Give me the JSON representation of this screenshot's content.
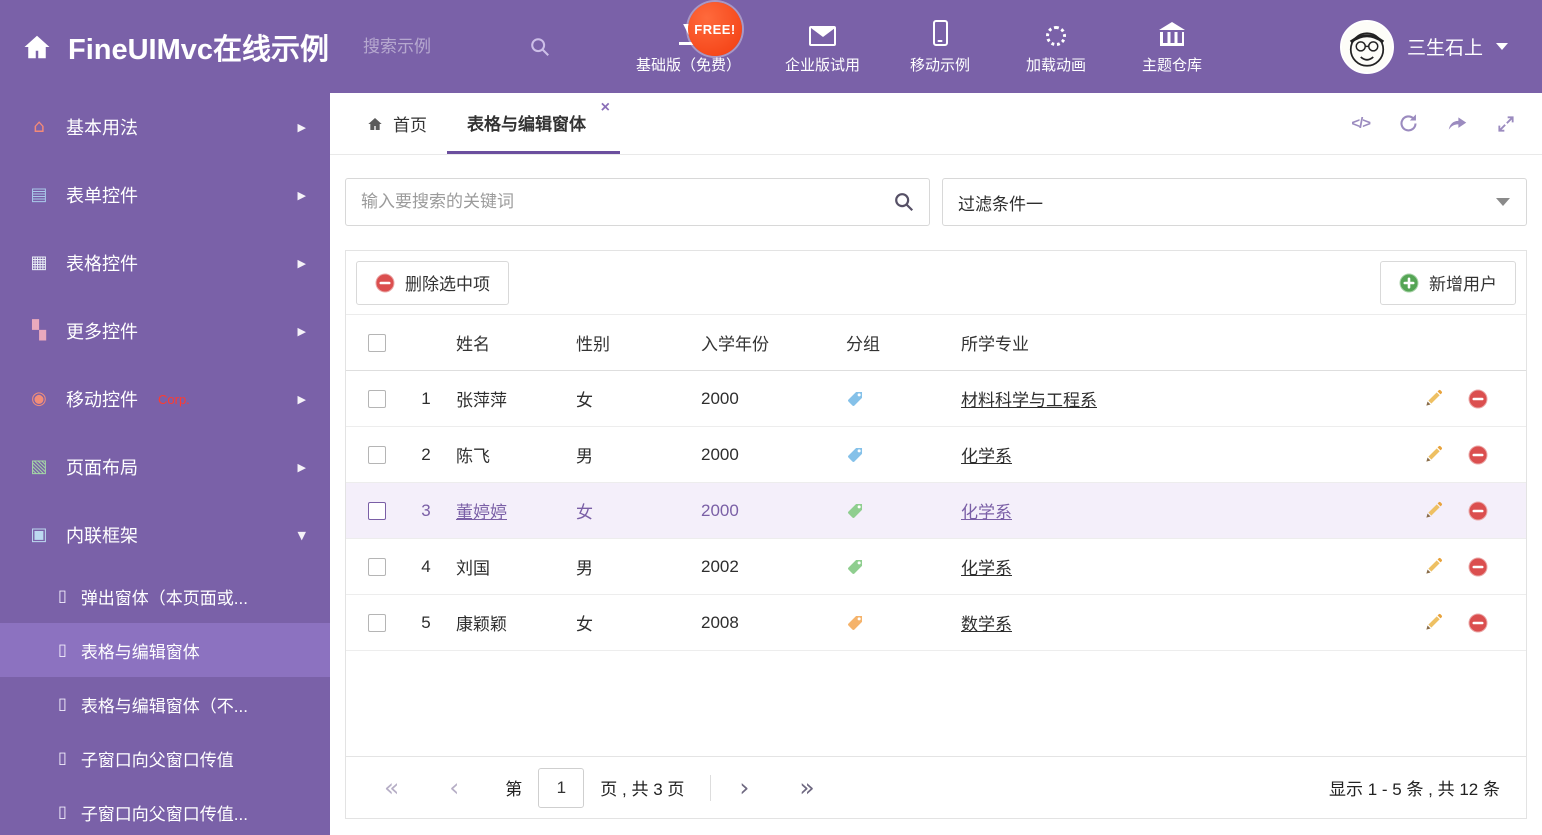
{
  "header": {
    "title": "FineUIMvc在线示例",
    "search_placeholder": "搜索示例",
    "free_badge": "FREE!",
    "nav": [
      {
        "icon": "download-icon",
        "label": "基础版（免费）"
      },
      {
        "icon": "mail-icon",
        "label": "企业版试用"
      },
      {
        "icon": "phone-icon",
        "label": "移动示例"
      },
      {
        "icon": "spinner-icon",
        "label": "加载动画"
      },
      {
        "icon": "bank-icon",
        "label": "主题仓库"
      }
    ],
    "user": {
      "name": "三生石上"
    }
  },
  "sidebar": {
    "items": [
      {
        "icon": "home-icon",
        "label": "基本用法"
      },
      {
        "icon": "form-icon",
        "label": "表单控件"
      },
      {
        "icon": "table-icon",
        "label": "表格控件"
      },
      {
        "icon": "more-icon",
        "label": "更多控件"
      },
      {
        "icon": "mobile-icon",
        "label": "移动控件",
        "badge": "Corp."
      },
      {
        "icon": "layout-icon",
        "label": "页面布局"
      },
      {
        "icon": "frame-icon",
        "label": "内联框架",
        "expanded": true
      }
    ],
    "subitems": [
      {
        "icon": "page-icon",
        "label": "弹出窗体（本页面或..."
      },
      {
        "icon": "page-icon",
        "label": "表格与编辑窗体",
        "active": true
      },
      {
        "icon": "page-icon",
        "label": "表格与编辑窗体（不..."
      },
      {
        "icon": "page-icon",
        "label": "子窗口向父窗口传值"
      },
      {
        "icon": "page-icon",
        "label": "子窗口向父窗口传值..."
      }
    ]
  },
  "tabs": {
    "home": "首页",
    "active": "表格与编辑窗体"
  },
  "filters": {
    "keyword_placeholder": "输入要搜索的关键词",
    "filter_selected": "过滤条件一"
  },
  "toolbar": {
    "delete_label": "删除选中项",
    "add_label": "新增用户"
  },
  "table": {
    "headers": [
      "姓名",
      "性别",
      "入学年份",
      "分组",
      "所学专业"
    ],
    "rows": [
      {
        "num": "1",
        "name": "张萍萍",
        "gender": "女",
        "year": "2000",
        "tag": "blue",
        "major": "材料科学与工程系"
      },
      {
        "num": "2",
        "name": "陈飞",
        "gender": "男",
        "year": "2000",
        "tag": "blue",
        "major": "化学系"
      },
      {
        "num": "3",
        "name": "董婷婷",
        "gender": "女",
        "year": "2000",
        "tag": "green",
        "major": "化学系",
        "selected": true
      },
      {
        "num": "4",
        "name": "刘国",
        "gender": "男",
        "year": "2002",
        "tag": "green",
        "major": "化学系"
      },
      {
        "num": "5",
        "name": "康颖颖",
        "gender": "女",
        "year": "2008",
        "tag": "orange",
        "major": "数学系"
      }
    ]
  },
  "pagination": {
    "page_prefix": "第",
    "current_page": "1",
    "page_suffix": "页 , 共 3 页",
    "summary": "显示 1 - 5 条 , 共 12 条"
  },
  "colors": {
    "brand_purple": "#7a61a8",
    "selected_purple": "#8c72c0",
    "active_tab_underline": "#6b4f9e",
    "free_badge_red": "#f23c0f",
    "delete_red": "#db4f4f",
    "add_green": "#55a555",
    "tag_blue": "#85c1e9",
    "tag_green": "#8fce8f",
    "tag_orange": "#f5b36b",
    "corp_badge_red": "#ff3b30",
    "selected_row_bg": "#f4effa"
  }
}
